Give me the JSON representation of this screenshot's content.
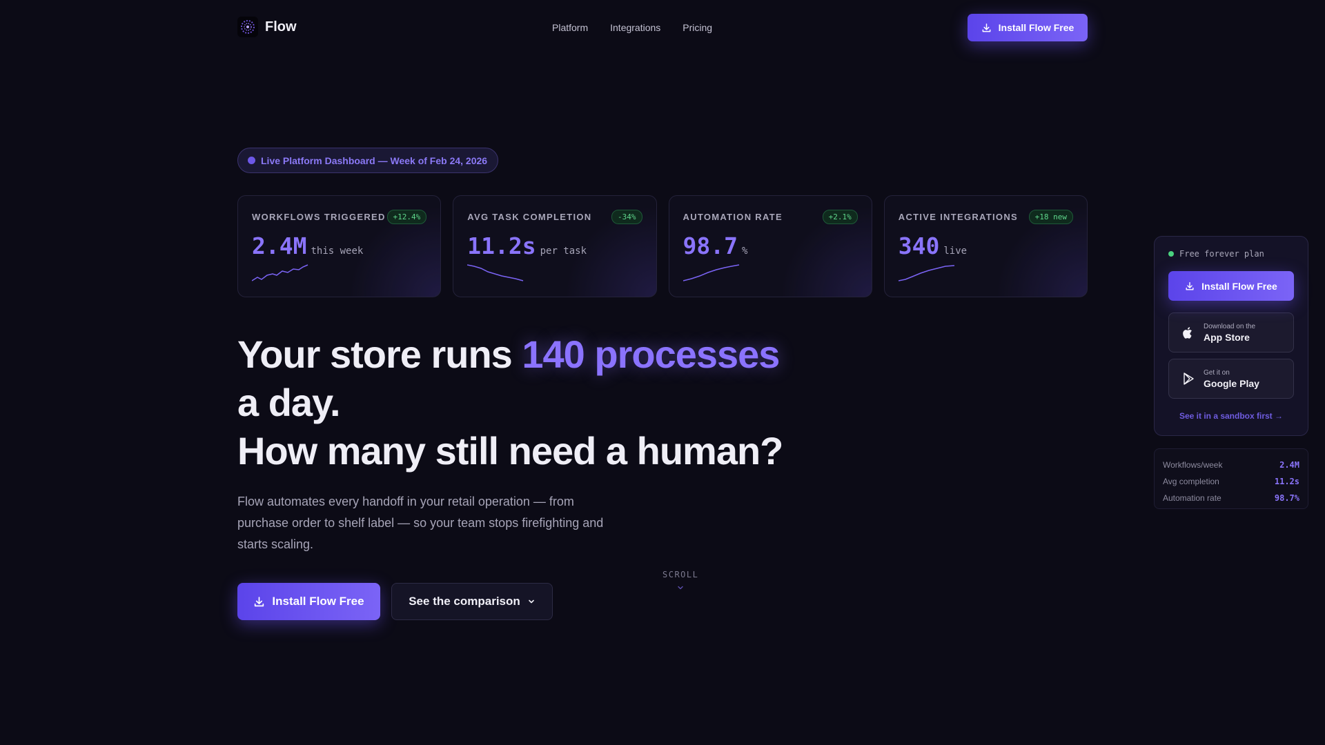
{
  "nav": {
    "brand": "Flow",
    "links": [
      "Platform",
      "Integrations",
      "Pricing"
    ],
    "cta": "Install Flow Free"
  },
  "badge": {
    "text": "Live Platform Dashboard — Week of Feb 24, 2026"
  },
  "cards": [
    {
      "label": "WORKFLOWS TRIGGERED",
      "delta": "+12.4%",
      "value": "2.4M",
      "unit": "this week"
    },
    {
      "label": "AVG TASK COMPLETION",
      "delta": "-34%",
      "value": "11.2s",
      "unit": "per task"
    },
    {
      "label": "AUTOMATION RATE",
      "delta": "+2.1%",
      "value": "98.7",
      "unit": "%"
    },
    {
      "label": "ACTIVE INTEGRATIONS",
      "delta": "+18 new",
      "value": "340",
      "unit": "live"
    }
  ],
  "hero": {
    "title_pre": "Your store runs ",
    "title_accent": "140 processes",
    "title_post": "a day.",
    "title_line2": "How many still need a human?",
    "subtitle": "Flow automates every handoff in your retail operation — from purchase order to shelf label — so your team stops firefighting and starts scaling.",
    "cta_primary": "Install Flow Free",
    "cta_secondary": "See the comparison",
    "scroll": "SCROLL"
  },
  "side": {
    "plan": "Free forever plan",
    "install": "Install Flow Free",
    "appstore_small": "Download on the",
    "appstore_big": "App Store",
    "gplay_small": "Get it on",
    "gplay_big": "Google Play",
    "sandbox": "See it in a sandbox first →"
  },
  "mini_stats": [
    {
      "label": "Workflows/week",
      "value": "2.4M"
    },
    {
      "label": "Avg completion",
      "value": "11.2s"
    },
    {
      "label": "Automation rate",
      "value": "98.7%"
    }
  ],
  "colors": {
    "accent": "#7b64f6",
    "positive": "#5fd68b",
    "background": "#0c0b16"
  },
  "icons": [
    "flow-logo-icon",
    "download-icon",
    "chevron-down-icon",
    "apple-icon",
    "google-play-icon"
  ]
}
